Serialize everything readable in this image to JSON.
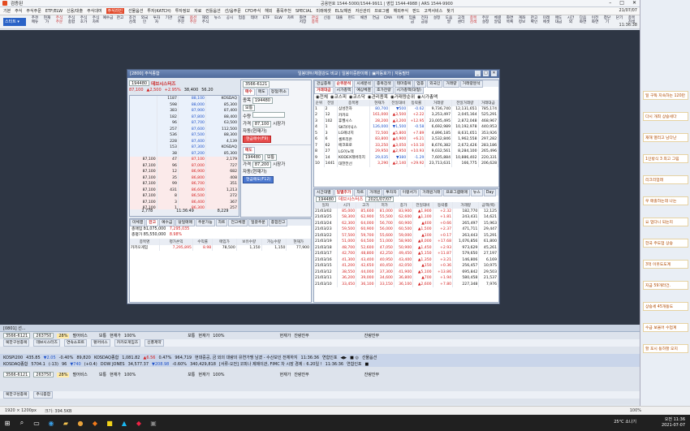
{
  "app": {
    "title": "검증된",
    "top_info": "공용번호 1544-5000/1544-9911 | 영업 1544-4988 | ARS 1544-9900",
    "clock": "21/07/07",
    "clock2": "11:36:38"
  },
  "menu": [
    "기본",
    "주식",
    "주식주문",
    "ETF/ELW",
    "신용/대출",
    "주식대여",
    "주식라인",
    "선물옵션",
    "투자(KATCH)",
    "투자정보",
    "자료",
    "컨틀옵션",
    "선/옵주문",
    "CFD주식",
    "해외",
    "종목추천",
    "SPECIAL",
    "미래에셋",
    "ELS/채권",
    "자산관리",
    "프로그램",
    "해외주식",
    "펀드",
    "고객서비스",
    "찾기"
  ],
  "menu_highlight": "주식라인",
  "toolbar": [
    {
      "l": "추천\n메뉴",
      "c": "n"
    },
    {
      "l": "현재\n가",
      "c": "n"
    },
    {
      "l": "주식\n주문",
      "c": "r"
    },
    {
      "l": "주식\n종합",
      "c": "n"
    },
    {
      "l": "주식\n호가",
      "c": "n"
    },
    {
      "l": "주식\n차트",
      "c": "n"
    },
    {
      "l": "예수금",
      "c": "n"
    },
    {
      "l": "잔고",
      "c": "n"
    },
    {
      "l": "조건\n검색",
      "c": "n"
    },
    {
      "l": "외국\n인",
      "c": "n"
    },
    {
      "l": "투자\n자",
      "c": "n"
    },
    {
      "l": "기관",
      "c": "n"
    },
    {
      "l": "선물\n주문",
      "c": "n"
    },
    {
      "l": "옵션\n주문",
      "c": "r"
    },
    {
      "l": "해외\n주식",
      "c": "n"
    },
    {
      "l": "뉴스",
      "c": "n"
    },
    {
      "l": "공시",
      "c": "n"
    },
    {
      "l": "업종",
      "c": "n"
    },
    {
      "l": "테마",
      "c": "n"
    },
    {
      "l": "ETF",
      "c": "n"
    },
    {
      "l": "ELW",
      "c": "n"
    },
    {
      "l": "차트",
      "c": "n"
    },
    {
      "l": "화면\n저장",
      "c": "n"
    },
    {
      "l": "관심\n종목",
      "c": "r"
    },
    {
      "l": "신용",
      "c": "n"
    },
    {
      "l": "대출",
      "c": "n"
    },
    {
      "l": "펀드",
      "c": "n"
    },
    {
      "l": "채권",
      "c": "n"
    },
    {
      "l": "연금",
      "c": "n"
    },
    {
      "l": "CMA",
      "c": "n"
    },
    {
      "l": "이체",
      "c": "n"
    },
    {
      "l": "입출\n금",
      "c": "n"
    },
    {
      "l": "전자\n금융",
      "c": "n"
    },
    {
      "l": "설정",
      "c": "n"
    },
    {
      "l": "도움\n말",
      "c": "n"
    },
    {
      "l": "고객\n센터",
      "c": "n"
    },
    {
      "l": "종목\n검색",
      "c": "r"
    },
    {
      "l": "주문\n설정",
      "c": "n"
    },
    {
      "l": "체결\n알림",
      "c": "n"
    },
    {
      "l": "화면\n목록",
      "c": "n"
    },
    {
      "l": "계좌\n정보",
      "c": "n"
    },
    {
      "l": "잔고\n확인",
      "c": "n"
    },
    {
      "l": "미래\n에셋",
      "c": "n"
    },
    {
      "l": "매도\n대금",
      "c": "n"
    },
    {
      "l": "시간\n외",
      "c": "n"
    },
    {
      "l": "다음\n화면",
      "c": "n"
    },
    {
      "l": "이전\n화면",
      "c": "n"
    },
    {
      "l": "창닫\n기",
      "c": "n"
    },
    {
      "l": "닫기",
      "c": "n"
    },
    {
      "l": "종목\n검색",
      "c": "n"
    }
  ],
  "quick_label": "스타트 ▾",
  "window": {
    "title": "[2800] 주식종합",
    "center_title": "일봉대두/체결강도 비교 | 일봉이중판이메 | ▣자동호가 | 자동필터"
  },
  "stock": {
    "code": "194480",
    "name": "데브시스터즈",
    "price": "87,100",
    "change": "▲2,500",
    "rate": "+2.95%",
    "volume": "38,400",
    "ratio": "56.20"
  },
  "orderbook": {
    "asks": [
      [
        "1187",
        "88,100",
        "▲2,050",
        ""
      ],
      [
        "598",
        "88,000",
        "",
        ""
      ],
      [
        "383",
        "87,900",
        "",
        ""
      ],
      [
        "182",
        "87,800",
        "",
        ""
      ],
      [
        "96",
        "87,700",
        "",
        ""
      ],
      [
        "257",
        "87,600",
        "",
        ""
      ],
      [
        "536",
        "87,500",
        "",
        ""
      ],
      [
        "228",
        "87,400",
        "",
        ""
      ],
      [
        "153",
        "87,300",
        "",
        ""
      ],
      [
        "38",
        "87,200",
        "",
        ""
      ]
    ],
    "bids": [
      [
        "",
        "87,100",
        "2,179",
        "up"
      ],
      [
        "",
        "87,000",
        "727",
        ""
      ],
      [
        "",
        "86,900",
        "682",
        ""
      ],
      [
        "",
        "86,800",
        "408",
        ""
      ],
      [
        "",
        "86,700",
        "351",
        ""
      ],
      [
        "",
        "86,600",
        "1,213",
        ""
      ],
      [
        "",
        "86,500",
        "272",
        ""
      ],
      [
        "",
        "86,400",
        "367",
        ""
      ],
      [
        "",
        "86,300",
        "257",
        ""
      ],
      [
        "",
        "86,200",
        "1,624",
        ""
      ]
    ],
    "leftbids": [
      "87,100",
      "87,100",
      "87,100",
      "87,100",
      "87,100",
      "87,100",
      "87,100",
      "87,100",
      "87,100",
      "87,100"
    ],
    "leftqty": [
      "47",
      "96",
      "12",
      "35",
      "99",
      "431",
      "8",
      "3",
      "1",
      "1"
    ],
    "total_ask": "2,778",
    "time": "11:36:49",
    "total_bid": "8,229",
    "after": "시간외"
  },
  "info_side": {
    "rows": [
      [
        "KOSDAQ",
        "1,036.82"
      ],
      [
        "85,300",
        "38,400"
      ],
      [
        "87,400",
        "85,700"
      ],
      [
        "88,400",
        "83,000"
      ],
      [
        "63,500",
        "50,880"
      ],
      [
        "112,500",
        "3,250"
      ],
      [
        "88,300",
        "10,000"
      ],
      [
        "4,139",
        "227,200"
      ]
    ]
  },
  "order": {
    "account": "3566-6121",
    "tabs": [
      "매수",
      "매도",
      "정정/취소"
    ],
    "type_label": "종목",
    "type": "보통",
    "qty_label": "수량",
    "price_label": "가격",
    "price": "87,100",
    "buy_btn": "현금매수(F9)",
    "sell_btn": "현금매도(F12)",
    "market": "시장가",
    "auto": "자동(현재가)",
    "price2": "87,200",
    "sell_tab": "매도"
  },
  "balance": {
    "tabs": [
      "미체결",
      "잔고",
      "예수금",
      "당일매매",
      "주문가능",
      "차트",
      "전고체결",
      "일괄주문",
      "종합잔고"
    ],
    "labels": [
      "총매입",
      "총평가",
      "손익률"
    ],
    "values": [
      "81,075,000",
      "85,550,000",
      "",
      "7,295,035",
      "8.98%",
      "",
      "0",
      "41,800"
    ],
    "headers": [
      "종목명",
      "평가손익",
      "수익률",
      "매입가",
      "보유수량",
      "가능수량",
      "현재가"
    ],
    "row": [
      "카카오게임",
      "7,295,895",
      "8.98",
      "78,500",
      "1,150",
      "1,150",
      "77,900"
    ]
  },
  "rank": {
    "tabs": [
      "관심종목",
      "순위분석",
      "시세분석",
      "종목검색",
      "테마종목",
      "업종",
      "외국인",
      "거래량",
      "거래량분석"
    ],
    "subtabs": [
      "거래대금",
      "시가총액",
      "예상체결",
      "호가잔량",
      "시가총액(대형)"
    ],
    "filters": [
      "전체",
      "코스피",
      "코스닥",
      "관리종목",
      "거래량순위",
      "시가총액"
    ],
    "headers": [
      "순위",
      "전일",
      "종목명",
      "현재가",
      "전일대비",
      "등락률",
      "거래량",
      "전일거래량",
      "거래대금"
    ],
    "rows": [
      [
        "1",
        "2",
        "삼성전자",
        "80,700",
        "▼",
        "500",
        "-0.62",
        "9,736,740",
        "12,131,651",
        "785,174"
      ],
      [
        "2",
        "12",
        "카카오",
        "161,000",
        "▲",
        "3,500",
        "+2.22",
        "3,253,497",
        "2,045,164",
        "525,291"
      ],
      [
        "3",
        "102",
        "휴젤시스",
        "28,200",
        "▲",
        "3,200",
        "+12.95",
        "23,005,495",
        "2,872,048",
        "468,967"
      ],
      [
        "4",
        "1",
        "SK하이닉스",
        "126,000",
        "▼",
        "1,500",
        "-0.58",
        "6,692,989",
        "10,192,978",
        "440,953"
      ],
      [
        "5",
        "3",
        "LG에너지",
        "72,500",
        "▲",
        "5,800",
        "+7.89",
        "4,896,185",
        "8,631,651",
        "353,926"
      ],
      [
        "6",
        "6",
        "셀트리온",
        "83,800",
        "▲",
        "4,900",
        "+6.21",
        "3,532,846",
        "1,962,558",
        "297,282"
      ],
      [
        "7",
        "62",
        "에코프로",
        "33,250",
        "▲",
        "3,050",
        "+10.10",
        "8,676,382",
        "2,672,426",
        "283,186"
      ],
      [
        "8",
        "27",
        "LG이노텍",
        "29,950",
        "▲",
        "2,950",
        "+10.93",
        "9,032,561",
        "8,284,100",
        "265,496"
      ],
      [
        "9",
        "14",
        "KODEX레버리지",
        "29,035",
        "▼",
        "380",
        "-1.29",
        "7,605,884",
        "10,886,402",
        "220,331"
      ],
      [
        "10",
        "1441",
        "대한전선",
        "3,290",
        "▲",
        "2,140",
        "+29.92",
        "23,713,631",
        "166,775",
        "206,628"
      ]
    ]
  },
  "daily": {
    "tabs": [
      "시간대별",
      "일별추가",
      "차트",
      "거래원",
      "투자자",
      "이평서가",
      "거래원거래",
      "프로그램매매",
      "뉴스",
      "Day"
    ],
    "code": "194480",
    "name": "데브시스터즈",
    "date": "2021/07/07",
    "headers": [
      "일자",
      "시가",
      "고가",
      "저가",
      "종가",
      "전일대비",
      "등락률",
      "거래량",
      "금액(백)"
    ],
    "rows": [
      [
        "21/03/02",
        "85,000",
        "85,600",
        "81,000",
        "83,900",
        "▲",
        "1,900",
        "+2.32",
        "182,770",
        "12,125"
      ],
      [
        "21/03/25",
        "58,300",
        "62,900",
        "55,500",
        "62,600",
        "▲",
        "1,100",
        "+1.81",
        "243,431",
        "14,621"
      ],
      [
        "21/03/24",
        "62,300",
        "64,000",
        "56,700",
        "60,900",
        "▲",
        "400",
        "+0.66",
        "265,497",
        "15,963"
      ],
      [
        "21/03/23",
        "59,500",
        "60,900",
        "56,000",
        "60,500",
        "▲",
        "1,500",
        "+2.37",
        "471,711",
        "29,447"
      ],
      [
        "21/03/22",
        "57,500",
        "59,700",
        "55,600",
        "59,000",
        "▲",
        "100",
        "+0.17",
        "263,443",
        "15,291"
      ],
      [
        "21/03/19",
        "51,000",
        "64,500",
        "51,000",
        "58,900",
        "▲",
        "8,000",
        "+17.68",
        "1,076,856",
        "61,800"
      ],
      [
        "21/03/18",
        "48,700",
        "52,600",
        "47,050",
        "50,900",
        "▲",
        "1,450",
        "+2.93",
        "973,629",
        "45,261"
      ],
      [
        "21/03/17",
        "42,700",
        "48,800",
        "42,250",
        "49,450",
        "▲",
        "5,150",
        "+11.87",
        "579,650",
        "27,197"
      ],
      [
        "21/03/16",
        "41,300",
        "43,400",
        "40,950",
        "43,400",
        "▲",
        "1,350",
        "+3.21",
        "146,806",
        "6,169"
      ],
      [
        "21/03/15",
        "41,200",
        "42,650",
        "40,450",
        "42,050",
        "▲",
        "150",
        "+0.36",
        "256,457",
        "10,975"
      ],
      [
        "21/03/12",
        "38,550",
        "44,000",
        "37,300",
        "41,900",
        "▲",
        "5,100",
        "+13.86",
        "695,842",
        "29,503"
      ],
      [
        "21/03/11",
        "36,200",
        "39,000",
        "34,600",
        "36,800",
        "▲",
        "700",
        "+1.94",
        "580,458",
        "21,537"
      ],
      [
        "21/03/10",
        "33,450",
        "36,100",
        "33,150",
        "36,100",
        "▲",
        "2,600",
        "+7.80",
        "227,348",
        "7,976"
      ]
    ]
  },
  "dock1": {
    "title": "[0801] 선...",
    "account": "3566-6121",
    "code": "263750",
    "pct": "28%",
    "name": "펄어비스",
    "kind": "보통",
    "price_label": "현재가",
    "price": "100%",
    "kind2": "보통",
    "price_label2": "현재가",
    "price2": "100%",
    "hwan": "현재가",
    "j1": "잔량잔부",
    "j2": "잔량잔부",
    "tabs": [
      "북한구성종목",
      "",
      "데브시스터즈",
      "연속소프트",
      "펄어비스",
      "카카오게임즈",
      "신풍제약"
    ],
    "row1": [
      "KOSPI200",
      "435.85",
      "▼2.05",
      "-0.40%",
      "89,820",
      "KOSDAQ종합",
      "1,081.82",
      "▲6.56",
      "0.47%",
      "964,719",
      "현대중공, 금 외의 대량의 유연가맹 남겼 - 수산보인 전체하지",
      "11:36:36",
      "연합인포",
      "◀▶",
      "■ ◎",
      "선물옵션"
    ],
    "row2": [
      "KOSDAQ종합",
      "5704.1",
      "(-13)",
      "96",
      "▼740",
      "(+0.4)",
      "DOW JONES",
      "34,577.37",
      "▼208.98",
      "-0.60%",
      "340,429,818",
      "[서류-오전] 코피나 제제이관, FIMC 차 시장 경제 : 6.20일 !",
      "11:36:36",
      "연합인포",
      "■",
      ""
    ]
  },
  "dock2": {
    "account": "3566-6121",
    "code": "263750",
    "pct": "28%",
    "name": "펄어비스",
    "kind": "보통",
    "price_label": "현재가",
    "price": "100%",
    "kind2": "보통",
    "price_label2": "현재가",
    "price2": "100%",
    "hwan": "현재가",
    "j1": "잔량잔부",
    "j2": "잔량잔부",
    "tabs": [
      "북한구성종목",
      "주식종합"
    ]
  },
  "status": {
    "dim": "1920 × 1200px",
    "size": "크기: 394.5KB",
    "zoom": "100%"
  },
  "taskbar": {
    "weather": "25°C 소나기",
    "time": "오전 11:36",
    "date": "2021-07-07"
  },
  "side_cards": [
    "일 구독 지속하는 120만",
    "다시 개최 상승세다",
    "재해 열리고 남다난",
    "1인방식 3 최고 그림",
    "리크리업래",
    "우 매출하는데 나는",
    "요 업다니 되는지 ",
    "한국 주도업 상승",
    "3억 이웃도도계",
    "지금 59개라건.",
    "상승세 45개동도",
    "수급 보울어 수업계",
    "할 포시 동하할 오지"
  ]
}
